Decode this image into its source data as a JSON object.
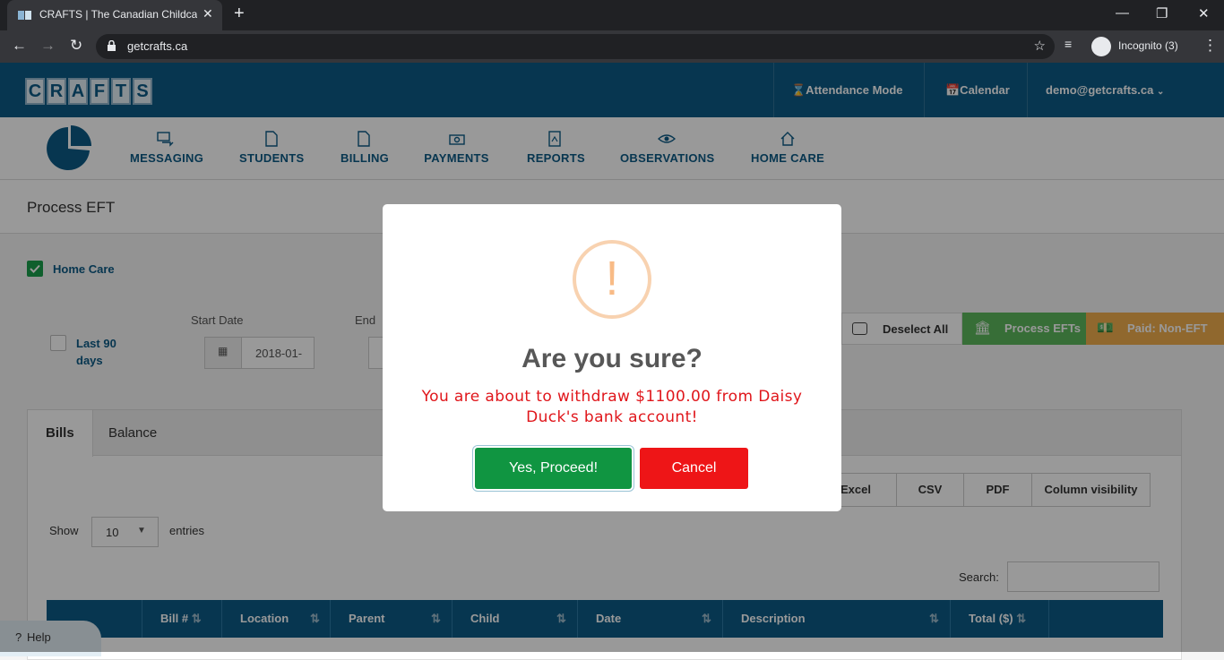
{
  "browser": {
    "tab_title": "CRAFTS | The Canadian Childcare",
    "tab_close": "✕",
    "new_tab": "+",
    "url": "getcrafts.ca",
    "incognito_label": "Incognito (3)",
    "win_min": "—",
    "win_restore": "❐",
    "win_close": "✕"
  },
  "header": {
    "logo_letters": [
      "C",
      "R",
      "A",
      "F",
      "T",
      "S"
    ],
    "attendance_mode": "⌛Attendance Mode",
    "calendar": "📅Calendar",
    "user_email": "demo@getcrafts.ca"
  },
  "nav": {
    "items": [
      {
        "label": "MESSAGING",
        "icon": "messaging-icon"
      },
      {
        "label": "STUDENTS",
        "icon": "document-icon"
      },
      {
        "label": "BILLING",
        "icon": "document-icon"
      },
      {
        "label": "PAYMENTS",
        "icon": "money-icon"
      },
      {
        "label": "REPORTS",
        "icon": "report-icon"
      },
      {
        "label": "OBSERVATIONS",
        "icon": "eye-icon"
      },
      {
        "label": "HOME CARE",
        "icon": "home-icon"
      }
    ]
  },
  "page": {
    "title": "Process EFT",
    "home_care_label": "Home Care",
    "last90_label_line1": "Last 90",
    "last90_label_line2": "days",
    "start_date_label": "Start Date",
    "start_date_value": "2018-01-",
    "end_date_label": "End",
    "deselect_all": "Deselect All",
    "process_efts": "Process EFTs",
    "paid_non_eft": "Paid: Non-EFT",
    "colors": {
      "green": "#5cb85c",
      "orange": "#f0ad4e",
      "brand": "#0d5a85"
    }
  },
  "table_panel": {
    "tabs": [
      "Bills",
      "Balance"
    ],
    "export_buttons": [
      "Excel",
      "CSV",
      "PDF",
      "Column visibility"
    ],
    "show_label": "Show",
    "entries_value": "10",
    "entries_label": "entries",
    "search_label": "Search:",
    "columns": [
      "",
      "Bill #",
      "Location",
      "Parent",
      "Child",
      "Date",
      "Description",
      "Total ($)",
      ""
    ]
  },
  "help": {
    "label": "Help"
  },
  "modal": {
    "icon": "!",
    "title": "Are you sure?",
    "text": "You are about to withdraw $1100.00 from Daisy Duck's bank account!",
    "confirm": "Yes, Proceed!",
    "cancel": "Cancel"
  }
}
